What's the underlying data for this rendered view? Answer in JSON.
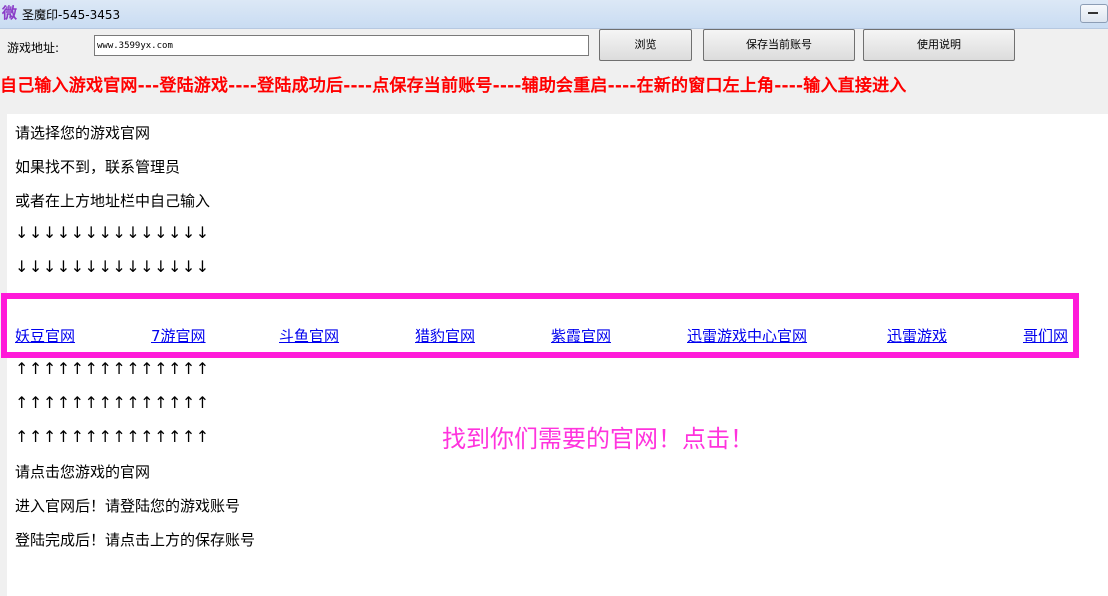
{
  "window": {
    "title": "圣魔印-545-3453",
    "icon": "app-logo-icon"
  },
  "toolbar": {
    "address_label": "游戏地址:",
    "address_value": "www.3599yx.com",
    "browse_label": "浏览",
    "save_label": "保存当前账号",
    "help_label": "使用说明"
  },
  "instructions": "自己输入游戏官网---登陆游戏----登陆成功后----点保存当前账号----辅助会重启----在新的窗口左上角----输入直接进入",
  "content": {
    "line1": "请选择您的游戏官网",
    "line2": "如果找不到，联系管理员",
    "line3": "或者在上方地址栏中自己输入",
    "down_arrows": "↓↓↓↓↓↓↓↓↓↓↓↓↓↓",
    "up_arrows": "↑↑↑↑↑↑↑↑↑↑↑↑↑↑",
    "links": [
      "妖豆官网",
      "7游官网",
      "斗鱼官网",
      "猎豹官网",
      "紫霞官网",
      "迅雷游戏中心官网",
      "迅雷游戏",
      "哥们网"
    ],
    "bottom1": "请点击您游戏的官网",
    "bottom2": "进入官网后！请登陆您的游戏账号",
    "bottom3": "登陆完成后！请点击上方的保存账号"
  },
  "callout": "找到你们需要的官网！点击！",
  "colors": {
    "instructions": "#ff0000",
    "highlight": "#ff1ad9",
    "callout": "#ff33dd",
    "link": "#0000ee"
  }
}
